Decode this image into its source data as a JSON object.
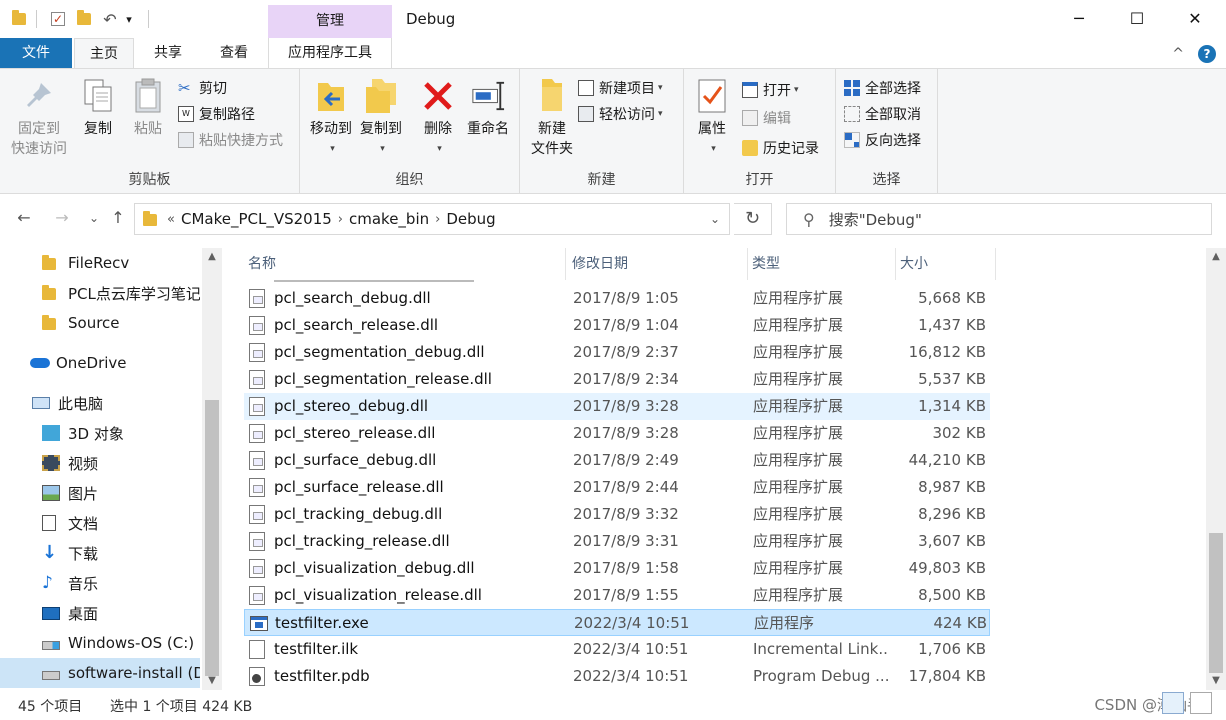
{
  "titlebar": {
    "title": "Debug",
    "context_tab": "管理",
    "quick_access_caret": "▾",
    "minimize": "─",
    "maximize": "☐",
    "close": "✕"
  },
  "tabs": {
    "file": "文件",
    "home": "主页",
    "share": "共享",
    "view": "查看",
    "app_tools": "应用程序工具",
    "collapse": "^",
    "help": "?"
  },
  "ribbon": {
    "clipboard": {
      "label": "剪贴板",
      "pin_line1": "固定到",
      "pin_line2": "快速访问",
      "copy": "复制",
      "paste": "粘贴",
      "cut": "剪切",
      "copy_path": "复制路径",
      "paste_shortcut": "粘贴快捷方式"
    },
    "organize": {
      "label": "组织",
      "move_to": "移动到",
      "copy_to": "复制到",
      "delete": "删除",
      "rename": "重命名"
    },
    "new": {
      "label": "新建",
      "new_folder_line1": "新建",
      "new_folder_line2": "文件夹",
      "new_item": "新建项目",
      "easy_access": "轻松访问"
    },
    "open": {
      "label": "打开",
      "properties": "属性",
      "open": "打开",
      "edit": "编辑",
      "history": "历史记录"
    },
    "select": {
      "label": "选择",
      "select_all": "全部选择",
      "select_none": "全部取消",
      "invert": "反向选择"
    }
  },
  "address": {
    "back": "←",
    "forward": "→",
    "recent": "⌄",
    "up": "↑",
    "overflow": "«",
    "crumbs": [
      "CMake_PCL_VS2015",
      "cmake_bin",
      "Debug"
    ],
    "separator": "›",
    "dropdown": "⌄",
    "refresh": "↻",
    "search_placeholder": "搜索\"Debug\""
  },
  "nav": {
    "items": [
      {
        "label": "FileRecv",
        "icon": "folder-icon"
      },
      {
        "label": "PCL点云库学习笔记",
        "icon": "folder-icon"
      },
      {
        "label": "Source",
        "icon": "folder-icon"
      },
      {
        "label": "OneDrive",
        "icon": "onedrive-icon"
      },
      {
        "label": "此电脑",
        "icon": "pc-icon"
      },
      {
        "label": "3D 对象",
        "icon": "3d-objects-icon"
      },
      {
        "label": "视频",
        "icon": "video-icon"
      },
      {
        "label": "图片",
        "icon": "pictures-icon"
      },
      {
        "label": "文档",
        "icon": "documents-icon"
      },
      {
        "label": "下载",
        "icon": "download-icon"
      },
      {
        "label": "音乐",
        "icon": "music-icon"
      },
      {
        "label": "桌面",
        "icon": "desktop-icon"
      },
      {
        "label": "Windows-OS (C:)",
        "icon": "drive-icon"
      },
      {
        "label": "software-install (D:)",
        "icon": "drive-icon"
      }
    ],
    "scroll_up": "▲",
    "scroll_down": "▼"
  },
  "columns": {
    "name": "名称",
    "date": "修改日期",
    "type": "类型",
    "size": "大小"
  },
  "files": [
    {
      "name": "pcl_search_debug.dll",
      "date": "2017/8/9 1:05",
      "type": "应用程序扩展",
      "size": "5,668 KB",
      "icon": "dll"
    },
    {
      "name": "pcl_search_release.dll",
      "date": "2017/8/9 1:04",
      "type": "应用程序扩展",
      "size": "1,437 KB",
      "icon": "dll"
    },
    {
      "name": "pcl_segmentation_debug.dll",
      "date": "2017/8/9 2:37",
      "type": "应用程序扩展",
      "size": "16,812 KB",
      "icon": "dll"
    },
    {
      "name": "pcl_segmentation_release.dll",
      "date": "2017/8/9 2:34",
      "type": "应用程序扩展",
      "size": "5,537 KB",
      "icon": "dll"
    },
    {
      "name": "pcl_stereo_debug.dll",
      "date": "2017/8/9 3:28",
      "type": "应用程序扩展",
      "size": "1,314 KB",
      "icon": "dll"
    },
    {
      "name": "pcl_stereo_release.dll",
      "date": "2017/8/9 3:28",
      "type": "应用程序扩展",
      "size": "302 KB",
      "icon": "dll"
    },
    {
      "name": "pcl_surface_debug.dll",
      "date": "2017/8/9 2:49",
      "type": "应用程序扩展",
      "size": "44,210 KB",
      "icon": "dll"
    },
    {
      "name": "pcl_surface_release.dll",
      "date": "2017/8/9 2:44",
      "type": "应用程序扩展",
      "size": "8,987 KB",
      "icon": "dll"
    },
    {
      "name": "pcl_tracking_debug.dll",
      "date": "2017/8/9 3:32",
      "type": "应用程序扩展",
      "size": "8,296 KB",
      "icon": "dll"
    },
    {
      "name": "pcl_tracking_release.dll",
      "date": "2017/8/9 3:31",
      "type": "应用程序扩展",
      "size": "3,607 KB",
      "icon": "dll"
    },
    {
      "name": "pcl_visualization_debug.dll",
      "date": "2017/8/9 1:58",
      "type": "应用程序扩展",
      "size": "49,803 KB",
      "icon": "dll"
    },
    {
      "name": "pcl_visualization_release.dll",
      "date": "2017/8/9 1:55",
      "type": "应用程序扩展",
      "size": "8,500 KB",
      "icon": "dll"
    },
    {
      "name": "testfilter.exe",
      "date": "2022/3/4 10:51",
      "type": "应用程序",
      "size": "424 KB",
      "icon": "exe"
    },
    {
      "name": "testfilter.ilk",
      "date": "2022/3/4 10:51",
      "type": "Incremental Link...",
      "size": "1,706 KB",
      "icon": "file"
    },
    {
      "name": "testfilter.pdb",
      "date": "2022/3/4 10:51",
      "type": "Program Debug ...",
      "size": "17,804 KB",
      "icon": "pdb"
    }
  ],
  "status": {
    "item_count": "45 个项目",
    "selection": "选中 1 个项目  424 KB",
    "watermark": "CSDN @潮汕手"
  },
  "colors": {
    "file_tab": "#1a73b6",
    "manage_tab": "#e8d4f7",
    "selection": "#cce8ff",
    "hover": "#e5f3ff"
  }
}
